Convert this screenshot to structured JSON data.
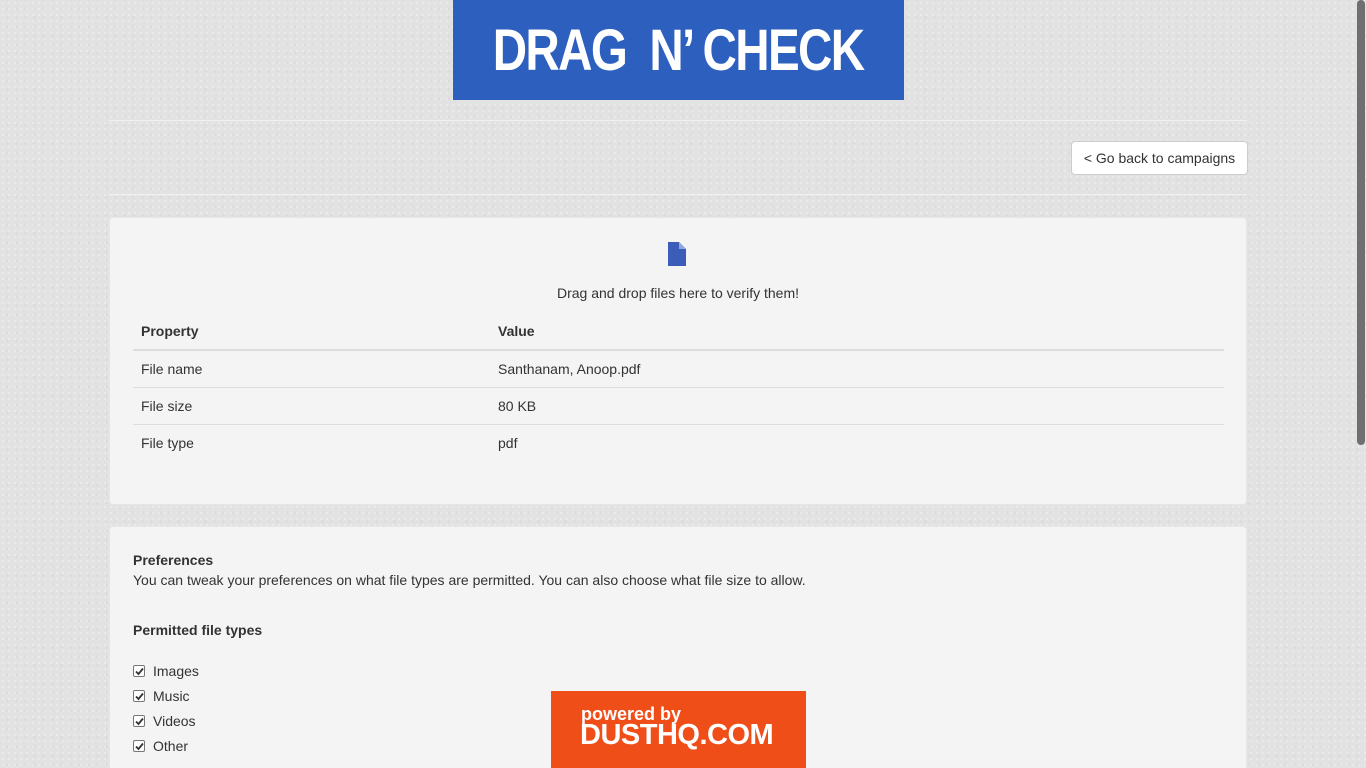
{
  "header": {
    "logo_text": "DRAG  N’ CHECK"
  },
  "toolbar": {
    "back_label": "< Go back to campaigns"
  },
  "dropzone": {
    "icon": "file-icon",
    "text": "Drag and drop files here to verify them!"
  },
  "properties": {
    "headers": [
      "Property",
      "Value"
    ],
    "rows": [
      [
        "File name",
        "Santhanam, Anoop.pdf"
      ],
      [
        "File size",
        "80 KB"
      ],
      [
        "File type",
        "pdf"
      ]
    ]
  },
  "preferences": {
    "title": "Preferences",
    "description": "You can tweak your preferences on what file types are permitted. You can also choose what file size to allow.",
    "permitted_title": "Permitted file types",
    "file_types": [
      {
        "label": "Images",
        "checked": true
      },
      {
        "label": "Music",
        "checked": true
      },
      {
        "label": "Videos",
        "checked": true
      },
      {
        "label": "Other",
        "checked": true
      }
    ]
  },
  "footer_badge": {
    "line1": "powered by",
    "line2": "DUSTHQ.COM"
  },
  "colors": {
    "brand_blue": "#2d5fbf",
    "badge_orange": "#f04e18"
  }
}
